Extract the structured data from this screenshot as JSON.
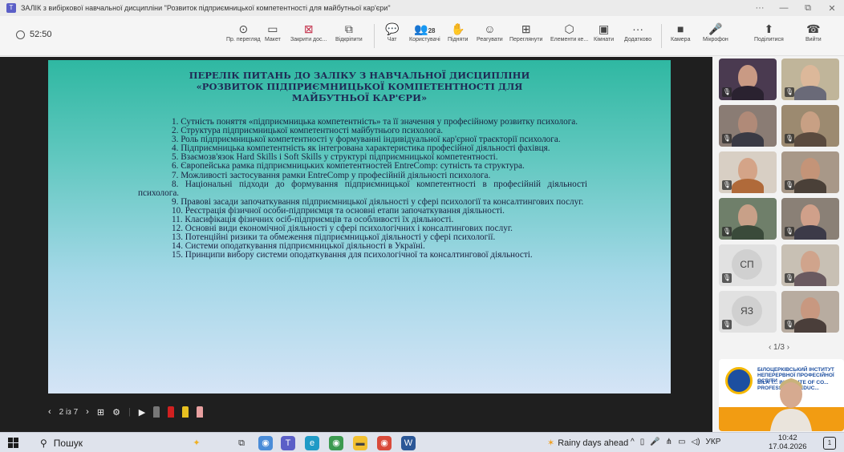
{
  "window": {
    "title": "ЗАЛІК з вибіркової навчальної дисципліни \"Розвиток підприємницької компетентності для майбутньої кар'єри\"",
    "controls": [
      "···",
      "—",
      "⧉",
      "✕"
    ]
  },
  "toolbar": {
    "timer": "52:50",
    "items": [
      {
        "name": "prev-view",
        "label": "Пр. перегляд",
        "icon": "⊙"
      },
      {
        "name": "layout",
        "label": "Макет",
        "icon": "▭"
      },
      {
        "name": "stop-share",
        "label": "Закрити дос...",
        "icon": "⊠"
      },
      {
        "name": "pop-out",
        "label": "Відкріпити",
        "icon": "⧉"
      },
      {
        "name": "chat",
        "label": "Чат",
        "icon": "💬"
      },
      {
        "name": "people",
        "label": "Користувачі",
        "icon": "👥",
        "badge": "28"
      },
      {
        "name": "raise-hand",
        "label": "Підняти",
        "icon": "✋"
      },
      {
        "name": "react",
        "label": "Реагувати",
        "icon": "☺"
      },
      {
        "name": "view",
        "label": "Переглянути",
        "icon": "⊞"
      },
      {
        "name": "apps",
        "label": "Елементи ке...",
        "icon": "⬡"
      },
      {
        "name": "rooms",
        "label": "Кімнати",
        "icon": "▣"
      },
      {
        "name": "more",
        "label": "Додатково",
        "icon": "···"
      },
      {
        "name": "camera",
        "label": "Камера",
        "icon": "■"
      },
      {
        "name": "mic",
        "label": "Мікрофон",
        "icon": "🎤"
      },
      {
        "name": "share",
        "label": "Поділитися",
        "icon": "⬆"
      },
      {
        "name": "leave",
        "label": "Вийти",
        "icon": "☎"
      }
    ]
  },
  "slide": {
    "title_lines": [
      "ПЕРЕЛІК ПИТАНЬ ДО ЗАЛІКУ З НАВЧАЛЬНОЇ ДИСЦИПЛІНИ",
      "«РОЗВИТОК ПІДПРИЄМНИЦЬКОЇ КОМПЕТЕНТНОСТІ ДЛЯ",
      "МАЙБУТНЬОЇ КАР'ЄРИ»"
    ],
    "questions": [
      "1.  Сутність поняття «підприємницька компетентність» та її значення у професійному розвитку психолога.",
      "2.  Структура підприємницької компетентності майбутнього психолога.",
      "3.  Роль підприємницької компетентності у формуванні індивідуальної кар'єрної траєкторії психолога.",
      "4.  Підприємницька компетентність як інтегрована характеристика професійної діяльності фахівця.",
      "5.  Взаємозв'язок Hard Skills і Soft Skills у структурі підприємницької компетентності.",
      "6.  Європейська рамка підприємницьких компетентностей EntreComp: сутність та структура.",
      "7.  Можливості застосування рамки EntreComp у професійній діяльності психолога.",
      "8.  Національні підходи до формування підприємницької компетентності в професійній діяльності психолога.",
      "9.  Правові засади започаткування підприємницької діяльності у сфері психології та консалтингових послуг.",
      "10. Реєстрація фізичної особи-підприємця та основні етапи започаткування діяльності.",
      "11. Класифікація фізичних осіб-підприємців та особливості їх діяльності.",
      "12. Основні види економічної діяльності у сфері психологічних і консалтингових послуг.",
      "13. Потенційні ризики та обмеження підприємницької діяльності у сфері психології.",
      "14. Системи оподаткування підприємницької діяльності в Україні.",
      "15. Принципи вибору системи оподаткування для психологічної та консалтингової діяльності."
    ]
  },
  "presentation": {
    "page": "2 із 7"
  },
  "participants": {
    "initials": [
      "СП",
      "ЯЗ"
    ],
    "pager": "1/3",
    "banner_line1": "БІЛОЦЕРКІВСЬКИЙ ІНСТИТУТ НЕПЕРЕРВНОЇ ПРОФЕСІЙНОЇ ОСВІТИ",
    "banner_line2": "BILA T... INSTITUTE OF CO... PROFESSIONAL EDUC..."
  },
  "taskbar": {
    "search": "Пошук",
    "weather": "Rainy days ahead",
    "lang": "УКР",
    "time": "10:42",
    "date": "17.04.2026",
    "notif_count": "1"
  }
}
